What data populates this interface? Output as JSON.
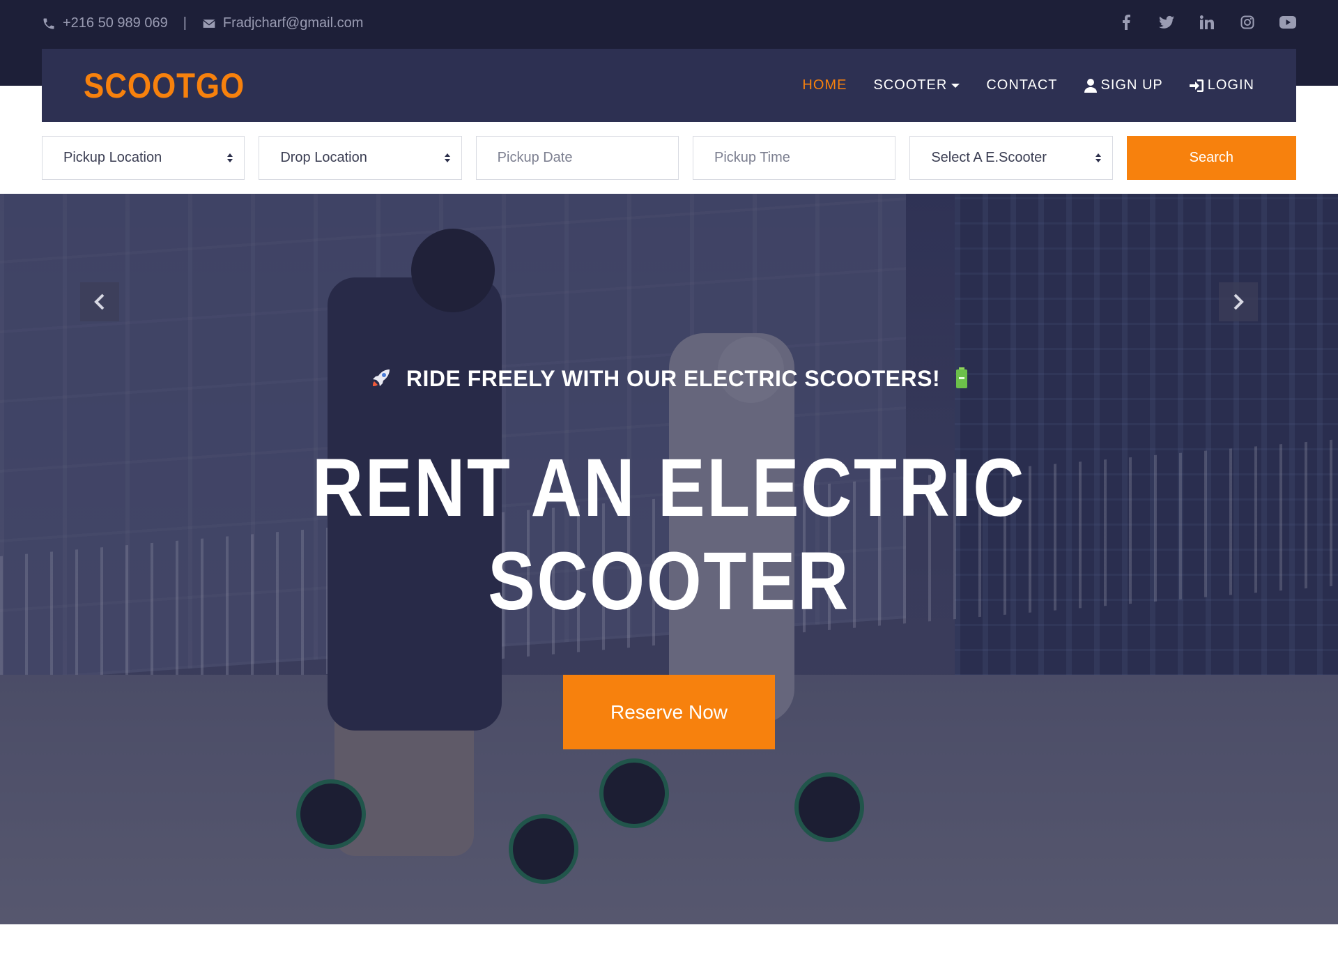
{
  "topbar": {
    "phone": "+216 50 989 069",
    "separator": "|",
    "email": "Fradjcharf@gmail.com",
    "social": [
      {
        "name": "facebook-icon",
        "glyph": "f"
      },
      {
        "name": "twitter-icon",
        "glyph": "t"
      },
      {
        "name": "linkedin-icon",
        "glyph": "in"
      },
      {
        "name": "instagram-icon",
        "glyph": "ig"
      },
      {
        "name": "youtube-icon",
        "glyph": "yt"
      }
    ]
  },
  "navbar": {
    "logo": "SCOOTGO",
    "items": {
      "home": "HOME",
      "scooter": "SCOOTER",
      "contact": "CONTACT",
      "signup": "SIGN UP",
      "login": "LOGIN"
    }
  },
  "search": {
    "pickup_location": "Pickup Location",
    "drop_location": "Drop Location",
    "pickup_date": "Pickup Date",
    "pickup_time": "Pickup Time",
    "scooter_select": "Select A E.Scooter",
    "button": "Search"
  },
  "hero": {
    "tagline": "RIDE FREELY WITH OUR ELECTRIC SCOOTERS!",
    "headline_line1": "RENT AN ELECTRIC",
    "headline_line2": "SCOOTER",
    "cta": "Reserve Now"
  },
  "colors": {
    "accent": "#f7810d",
    "dark": "#1d1f38",
    "navbar": "#2d3052"
  }
}
